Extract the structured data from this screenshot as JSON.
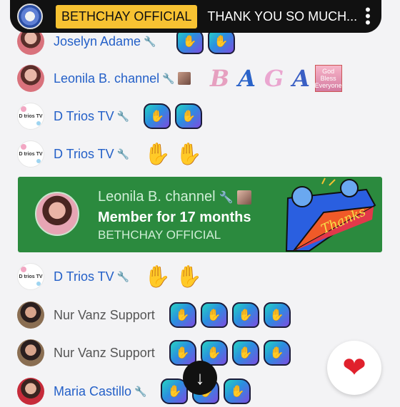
{
  "header": {
    "channel_pill": "BETHCHAY OFFICIAL",
    "pinned_message": "THANK YOU SO MUCH...",
    "menu_icon": "more-vert-icon"
  },
  "messages": [
    {
      "author": "Joselyn Adame",
      "moderator": true,
      "emojis": [
        "sticker",
        "sticker"
      ]
    },
    {
      "author": "Leonila B. channel",
      "moderator": true,
      "member_badge": true,
      "emojis": [
        "B",
        "A",
        "G",
        "A",
        "God Bless Everyone"
      ]
    },
    {
      "author": "D Trios TV",
      "avatar_text": "D trios TV",
      "moderator": true,
      "emojis": [
        "sticker",
        "sticker"
      ]
    },
    {
      "author": "D Trios TV",
      "avatar_text": "D trios TV",
      "moderator": true,
      "emojis": [
        "wave",
        "wave"
      ]
    },
    {
      "author": "D Trios TV",
      "avatar_text": "D trios TV",
      "moderator": true,
      "emojis": [
        "wave",
        "wave"
      ]
    },
    {
      "author": "Nur Vanz Support",
      "moderator": false,
      "emojis": [
        "sticker",
        "sticker",
        "sticker",
        "sticker"
      ]
    },
    {
      "author": "Nur Vanz Support",
      "moderator": false,
      "emojis": [
        "sticker",
        "sticker",
        "sticker",
        "sticker"
      ]
    },
    {
      "author": "Maria Castillo",
      "moderator": true,
      "emojis": [
        "sticker",
        "sticker",
        "sticker"
      ]
    }
  ],
  "membership": {
    "name": "Leonila B. channel",
    "milestone": "Member for 17 months",
    "channel": "BETHCHAY OFFICIAL",
    "sticker_text": "Thanks"
  },
  "icons": {
    "wrench": "wrench-icon",
    "heart": "heart-icon",
    "scroll_down": "arrow-down-icon"
  },
  "colors": {
    "member_card": "#2b8a3e",
    "moderator_name": "#2460c8",
    "channel_pill": "#f7c232"
  }
}
